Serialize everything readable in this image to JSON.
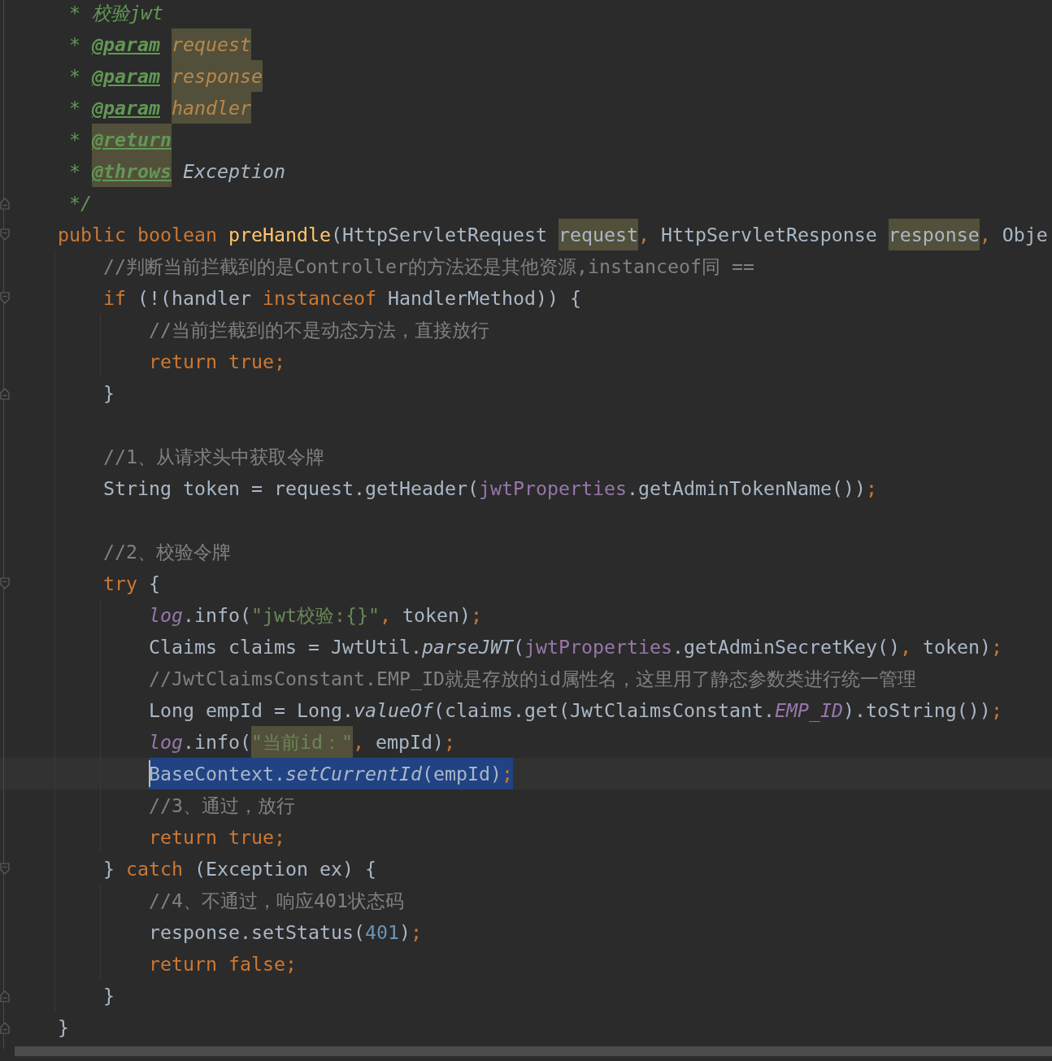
{
  "editor": {
    "lines": [
      {
        "kind": "code",
        "current": false,
        "selected": false,
        "tokens": [
          {
            "text": " * 校验jwt",
            "kind": "doc"
          }
        ]
      },
      {
        "kind": "code",
        "current": false,
        "selected": false,
        "tokens": [
          {
            "text": " * ",
            "kind": "doc"
          },
          {
            "text": "@param",
            "kind": "doctag"
          },
          {
            "text": "request",
            "kind": "docparam",
            "highlighted": true
          }
        ]
      },
      {
        "kind": "code",
        "current": false,
        "selected": false,
        "tokens": [
          {
            "text": " * ",
            "kind": "doc"
          },
          {
            "text": "@param",
            "kind": "doctag"
          },
          {
            "text": "response",
            "kind": "docparam",
            "highlighted": true
          }
        ]
      },
      {
        "kind": "code",
        "current": false,
        "selected": false,
        "tokens": [
          {
            "text": " * ",
            "kind": "doc"
          },
          {
            "text": "@param",
            "kind": "doctag"
          },
          {
            "text": "handler",
            "kind": "docparam",
            "highlighted": true
          }
        ]
      },
      {
        "kind": "code",
        "current": false,
        "selected": false,
        "tokens": [
          {
            "text": " * ",
            "kind": "doc"
          },
          {
            "text": "@return",
            "kind": "doctag",
            "highlighted": true
          }
        ]
      },
      {
        "kind": "code",
        "current": false,
        "selected": false,
        "tokens": [
          {
            "text": " * ",
            "kind": "doc"
          },
          {
            "text": "@throws",
            "kind": "doctag",
            "highlighted": true
          },
          {
            "text": "Exception",
            "kind": "docref"
          }
        ]
      },
      {
        "kind": "code",
        "current": false,
        "selected": false,
        "fold_end": true,
        "tokens": [
          {
            "text": " */",
            "kind": "doc"
          }
        ]
      },
      {
        "kind": "code",
        "current": false,
        "selected": false,
        "tokens": [
          {
            "text": "public boolean ",
            "kind": "keyword"
          },
          {
            "text": "preHandle",
            "kind": "method"
          },
          {
            "text": "(HttpServletRequest ",
            "kind": "plain"
          },
          {
            "text": "request",
            "kind": "plain",
            "highlighted": true
          },
          {
            "text": ",",
            "kind": "keyword"
          },
          {
            "text": " HttpServletResponse ",
            "kind": "plain"
          },
          {
            "text": "response",
            "kind": "plain",
            "highlighted": true
          },
          {
            "text": ",",
            "kind": "keyword"
          },
          {
            "text": " Obje",
            "kind": "plain"
          }
        ],
        "children": [
          {
            "kind": "code",
            "current": false,
            "selected": false,
            "tokens": [
              {
                "text": "//判断当前拦截到的是Controller的方法还是其他资源,instanceof同 ==",
                "kind": "comment"
              }
            ]
          },
          {
            "kind": "code",
            "current": false,
            "selected": false,
            "tokens": [
              {
                "text": "if ",
                "kind": "keyword"
              },
              {
                "text": "(!(handler ",
                "kind": "plain"
              },
              {
                "text": "instanceof",
                "kind": "keyword"
              },
              {
                "text": " HandlerMethod)) {",
                "kind": "plain"
              }
            ],
            "children": [
              {
                "kind": "code",
                "current": false,
                "selected": false,
                "tokens": [
                  {
                    "text": "//当前拦截到的不是动态方法，直接放行",
                    "kind": "comment"
                  }
                ]
              },
              {
                "kind": "code",
                "current": false,
                "selected": false,
                "tokens": [
                  {
                    "text": "return true;",
                    "kind": "keyword"
                  }
                ]
              }
            ]
          },
          {
            "kind": "code",
            "current": false,
            "selected": false,
            "tokens": [
              {
                "text": "}",
                "kind": "plain"
              }
            ]
          },
          {
            "kind": "blank"
          },
          {
            "kind": "code",
            "current": false,
            "selected": false,
            "tokens": [
              {
                "text": "//1、从请求头中获取令牌",
                "kind": "comment"
              }
            ]
          },
          {
            "kind": "code",
            "current": false,
            "selected": false,
            "tokens": [
              {
                "text": "String token = request.getHeader(",
                "kind": "plain"
              },
              {
                "text": "jwtProperties",
                "kind": "field"
              },
              {
                "text": ".getAdminTokenName())",
                "kind": "plain"
              },
              {
                "text": ";",
                "kind": "keyword"
              }
            ]
          },
          {
            "kind": "blank"
          },
          {
            "kind": "code",
            "current": false,
            "selected": false,
            "tokens": [
              {
                "text": "//2、校验令牌",
                "kind": "comment"
              }
            ]
          },
          {
            "kind": "code",
            "current": false,
            "selected": false,
            "tokens": [
              {
                "text": "try",
                "kind": "keyword"
              },
              {
                "text": " {",
                "kind": "plain"
              }
            ],
            "children": [
              {
                "kind": "code",
                "current": false,
                "selected": false,
                "tokens": [
                  {
                    "text": "log",
                    "kind": "staticfield"
                  },
                  {
                    "text": ".info(",
                    "kind": "plain"
                  },
                  {
                    "text": "\"jwt校验:{}\"",
                    "kind": "string"
                  },
                  {
                    "text": ",",
                    "kind": "keyword"
                  },
                  {
                    "text": " token)",
                    "kind": "plain"
                  },
                  {
                    "text": ";",
                    "kind": "keyword"
                  }
                ]
              },
              {
                "kind": "code",
                "current": false,
                "selected": false,
                "tokens": [
                  {
                    "text": "Claims claims = JwtUtil.",
                    "kind": "plain"
                  },
                  {
                    "text": "parseJWT",
                    "kind": "staticcall"
                  },
                  {
                    "text": "(",
                    "kind": "plain"
                  },
                  {
                    "text": "jwtProperties",
                    "kind": "field"
                  },
                  {
                    "text": ".getAdminSecretKey()",
                    "kind": "plain"
                  },
                  {
                    "text": ",",
                    "kind": "keyword"
                  },
                  {
                    "text": " token)",
                    "kind": "plain"
                  },
                  {
                    "text": ";",
                    "kind": "keyword"
                  }
                ]
              },
              {
                "kind": "code",
                "current": false,
                "selected": false,
                "tokens": [
                  {
                    "text": "//JwtClaimsConstant.EMP_ID就是存放的id属性名，这里用了静态参数类进行统一管理",
                    "kind": "comment"
                  }
                ]
              },
              {
                "kind": "code",
                "current": false,
                "selected": false,
                "tokens": [
                  {
                    "text": "Long empId = Long.",
                    "kind": "plain"
                  },
                  {
                    "text": "valueOf",
                    "kind": "staticcall"
                  },
                  {
                    "text": "(claims.get(JwtClaimsConstant.",
                    "kind": "plain"
                  },
                  {
                    "text": "EMP_ID",
                    "kind": "constant"
                  },
                  {
                    "text": ").toString())",
                    "kind": "plain"
                  },
                  {
                    "text": ";",
                    "kind": "keyword"
                  }
                ]
              },
              {
                "kind": "code",
                "current": false,
                "selected": false,
                "tokens": [
                  {
                    "text": "log",
                    "kind": "staticfield"
                  },
                  {
                    "text": ".info(",
                    "kind": "plain"
                  },
                  {
                    "text": "\"当前id：\"",
                    "kind": "string",
                    "highlighted": true
                  },
                  {
                    "text": ",",
                    "kind": "keyword"
                  },
                  {
                    "text": " empId)",
                    "kind": "plain"
                  },
                  {
                    "text": ";",
                    "kind": "keyword"
                  }
                ]
              },
              {
                "kind": "code",
                "current": true,
                "selected": true,
                "tokens": [
                  {
                    "text": "BaseContext.",
                    "kind": "plain"
                  },
                  {
                    "text": "setCurrentId",
                    "kind": "staticcall"
                  },
                  {
                    "text": "(empId)",
                    "kind": "plain"
                  },
                  {
                    "text": ";",
                    "kind": "keyword"
                  }
                ]
              },
              {
                "kind": "code",
                "current": false,
                "selected": false,
                "tokens": [
                  {
                    "text": "//3、通过，放行",
                    "kind": "comment"
                  }
                ]
              },
              {
                "kind": "code",
                "current": false,
                "selected": false,
                "tokens": [
                  {
                    "text": "return true;",
                    "kind": "keyword"
                  }
                ]
              }
            ]
          },
          {
            "kind": "code",
            "current": false,
            "selected": false,
            "tokens": [
              {
                "text": "} ",
                "kind": "plain"
              },
              {
                "text": "catch",
                "kind": "keyword"
              },
              {
                "text": " (Exception ex) {",
                "kind": "plain"
              }
            ],
            "children": [
              {
                "kind": "code",
                "current": false,
                "selected": false,
                "tokens": [
                  {
                    "text": "//4、不通过，响应401状态码",
                    "kind": "comment"
                  }
                ]
              },
              {
                "kind": "code",
                "current": false,
                "selected": false,
                "tokens": [
                  {
                    "text": "response.setStatus(",
                    "kind": "plain"
                  },
                  {
                    "text": "401",
                    "kind": "number"
                  },
                  {
                    "text": ")",
                    "kind": "plain"
                  },
                  {
                    "text": ";",
                    "kind": "keyword"
                  }
                ]
              },
              {
                "kind": "code",
                "current": false,
                "selected": false,
                "tokens": [
                  {
                    "text": "return false;",
                    "kind": "keyword"
                  }
                ]
              }
            ]
          },
          {
            "kind": "code",
            "current": false,
            "selected": false,
            "tokens": [
              {
                "text": "}",
                "kind": "plain"
              }
            ]
          }
        ]
      },
      {
        "kind": "code",
        "current": false,
        "selected": false,
        "tokens": [
          {
            "text": "}",
            "kind": "plain"
          }
        ]
      }
    ]
  }
}
